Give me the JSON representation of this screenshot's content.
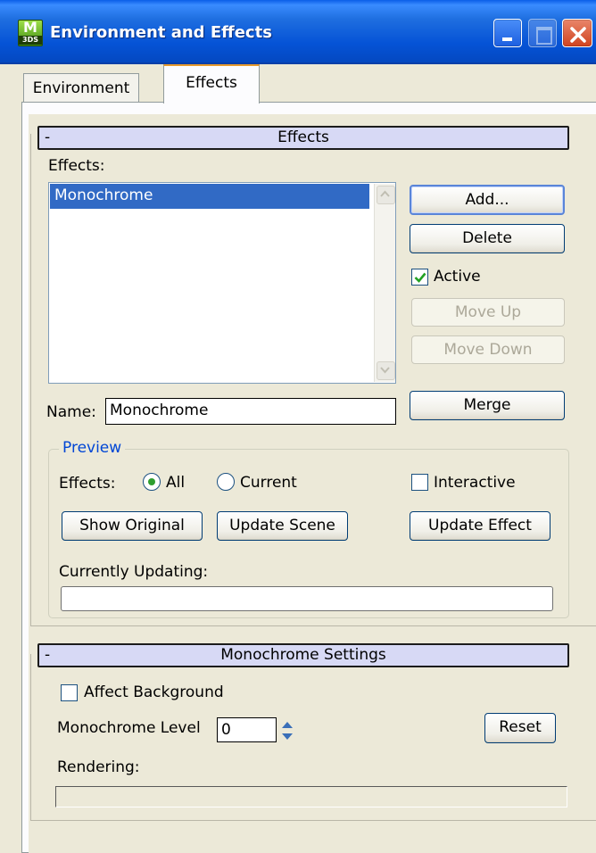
{
  "window": {
    "title": "Environment and Effects",
    "logo_top": "M",
    "logo_bottom": "3DS"
  },
  "tabs": [
    {
      "label": "Environment",
      "active": false
    },
    {
      "label": "Effects",
      "active": true
    }
  ],
  "effects_rollout": {
    "collapse_symbol": "-",
    "header": "Effects",
    "effects_label": "Effects:",
    "list_items": [
      "Monochrome"
    ],
    "selected_item": "Monochrome",
    "buttons": {
      "add": "Add...",
      "delete": "Delete",
      "move_up": "Move Up",
      "move_down": "Move Down",
      "merge": "Merge"
    },
    "active_label": "Active",
    "active_checked": true,
    "name_label": "Name:",
    "name_value": "Monochrome",
    "preview": {
      "legend": "Preview",
      "effects_label": "Effects:",
      "radio_all": "All",
      "radio_current": "Current",
      "selected": "All",
      "interactive_label": "Interactive",
      "interactive_checked": false,
      "show_original": "Show Original",
      "update_scene": "Update Scene",
      "update_effect": "Update Effect",
      "currently_updating_label": "Currently Updating:",
      "progress": 0
    }
  },
  "monochrome_rollout": {
    "collapse_symbol": "-",
    "header": "Monochrome Settings",
    "affect_background_label": "Affect Background",
    "affect_background_checked": false,
    "level_label": "Monochrome Level",
    "level_value": "0",
    "reset": "Reset",
    "rendering_label": "Rendering:",
    "progress": 0
  },
  "colors": {
    "titlebar": "#0553d6",
    "selection": "#316ac5",
    "rollout_header": "#d7d9f5",
    "preview_legend": "#0046d5"
  }
}
